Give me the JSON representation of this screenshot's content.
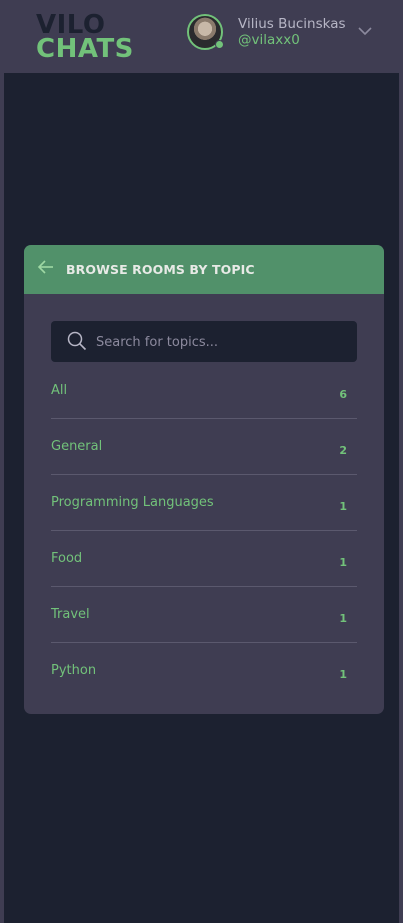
{
  "brand": {
    "logo_line1": "VILO",
    "logo_line2": "CHATS"
  },
  "user": {
    "name": "Vilius Bucinskas",
    "handle": "@vilaxx0",
    "status": "online"
  },
  "browse": {
    "title": "BROWSE ROOMS BY TOPIC",
    "search_placeholder": "Search for topics...",
    "topics": [
      {
        "name": "All",
        "count": "6"
      },
      {
        "name": "General",
        "count": "2"
      },
      {
        "name": "Programming Languages",
        "count": "1"
      },
      {
        "name": "Food",
        "count": "1"
      },
      {
        "name": "Travel",
        "count": "1"
      },
      {
        "name": "Python",
        "count": "1"
      }
    ]
  },
  "icons": {
    "back": "arrow-left-icon",
    "search": "search-icon",
    "dropdown": "chevron-down-icon"
  },
  "colors": {
    "accent": "#72c27a",
    "header_green": "#51916a",
    "background": "#1c2130",
    "panel": "#3f3d52"
  }
}
